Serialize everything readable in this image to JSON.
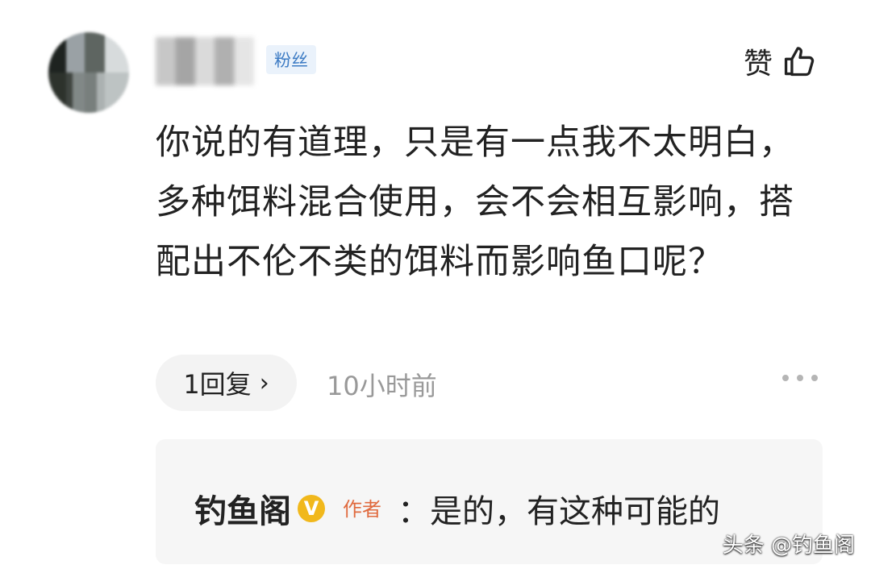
{
  "comment": {
    "badge": "粉丝",
    "like_label": "赞",
    "text": "你说的有道理，只是有一点我不太明白，多种饵料混合使用，会不会相互影响，搭配出不伦不类的饵料而影响鱼口呢？",
    "reply_count_label": "1回复",
    "reply_chevron": "›",
    "timestamp": "10小时前"
  },
  "reply": {
    "author": "钓鱼阁",
    "verified_symbol": "V",
    "author_tag": "作者",
    "text": "：是的，有这种可能的"
  },
  "watermark": "头条 @钓鱼阁",
  "colors": {
    "badge_bg": "#eaf2fb",
    "badge_text": "#3c7bc4",
    "verified": "#f1b81c",
    "author_tag": "#e06a3e",
    "timestamp": "#999999"
  },
  "icons": {
    "like": "thumbs-up-icon",
    "more": "more-dots-icon",
    "verified": "verified-v-icon"
  }
}
